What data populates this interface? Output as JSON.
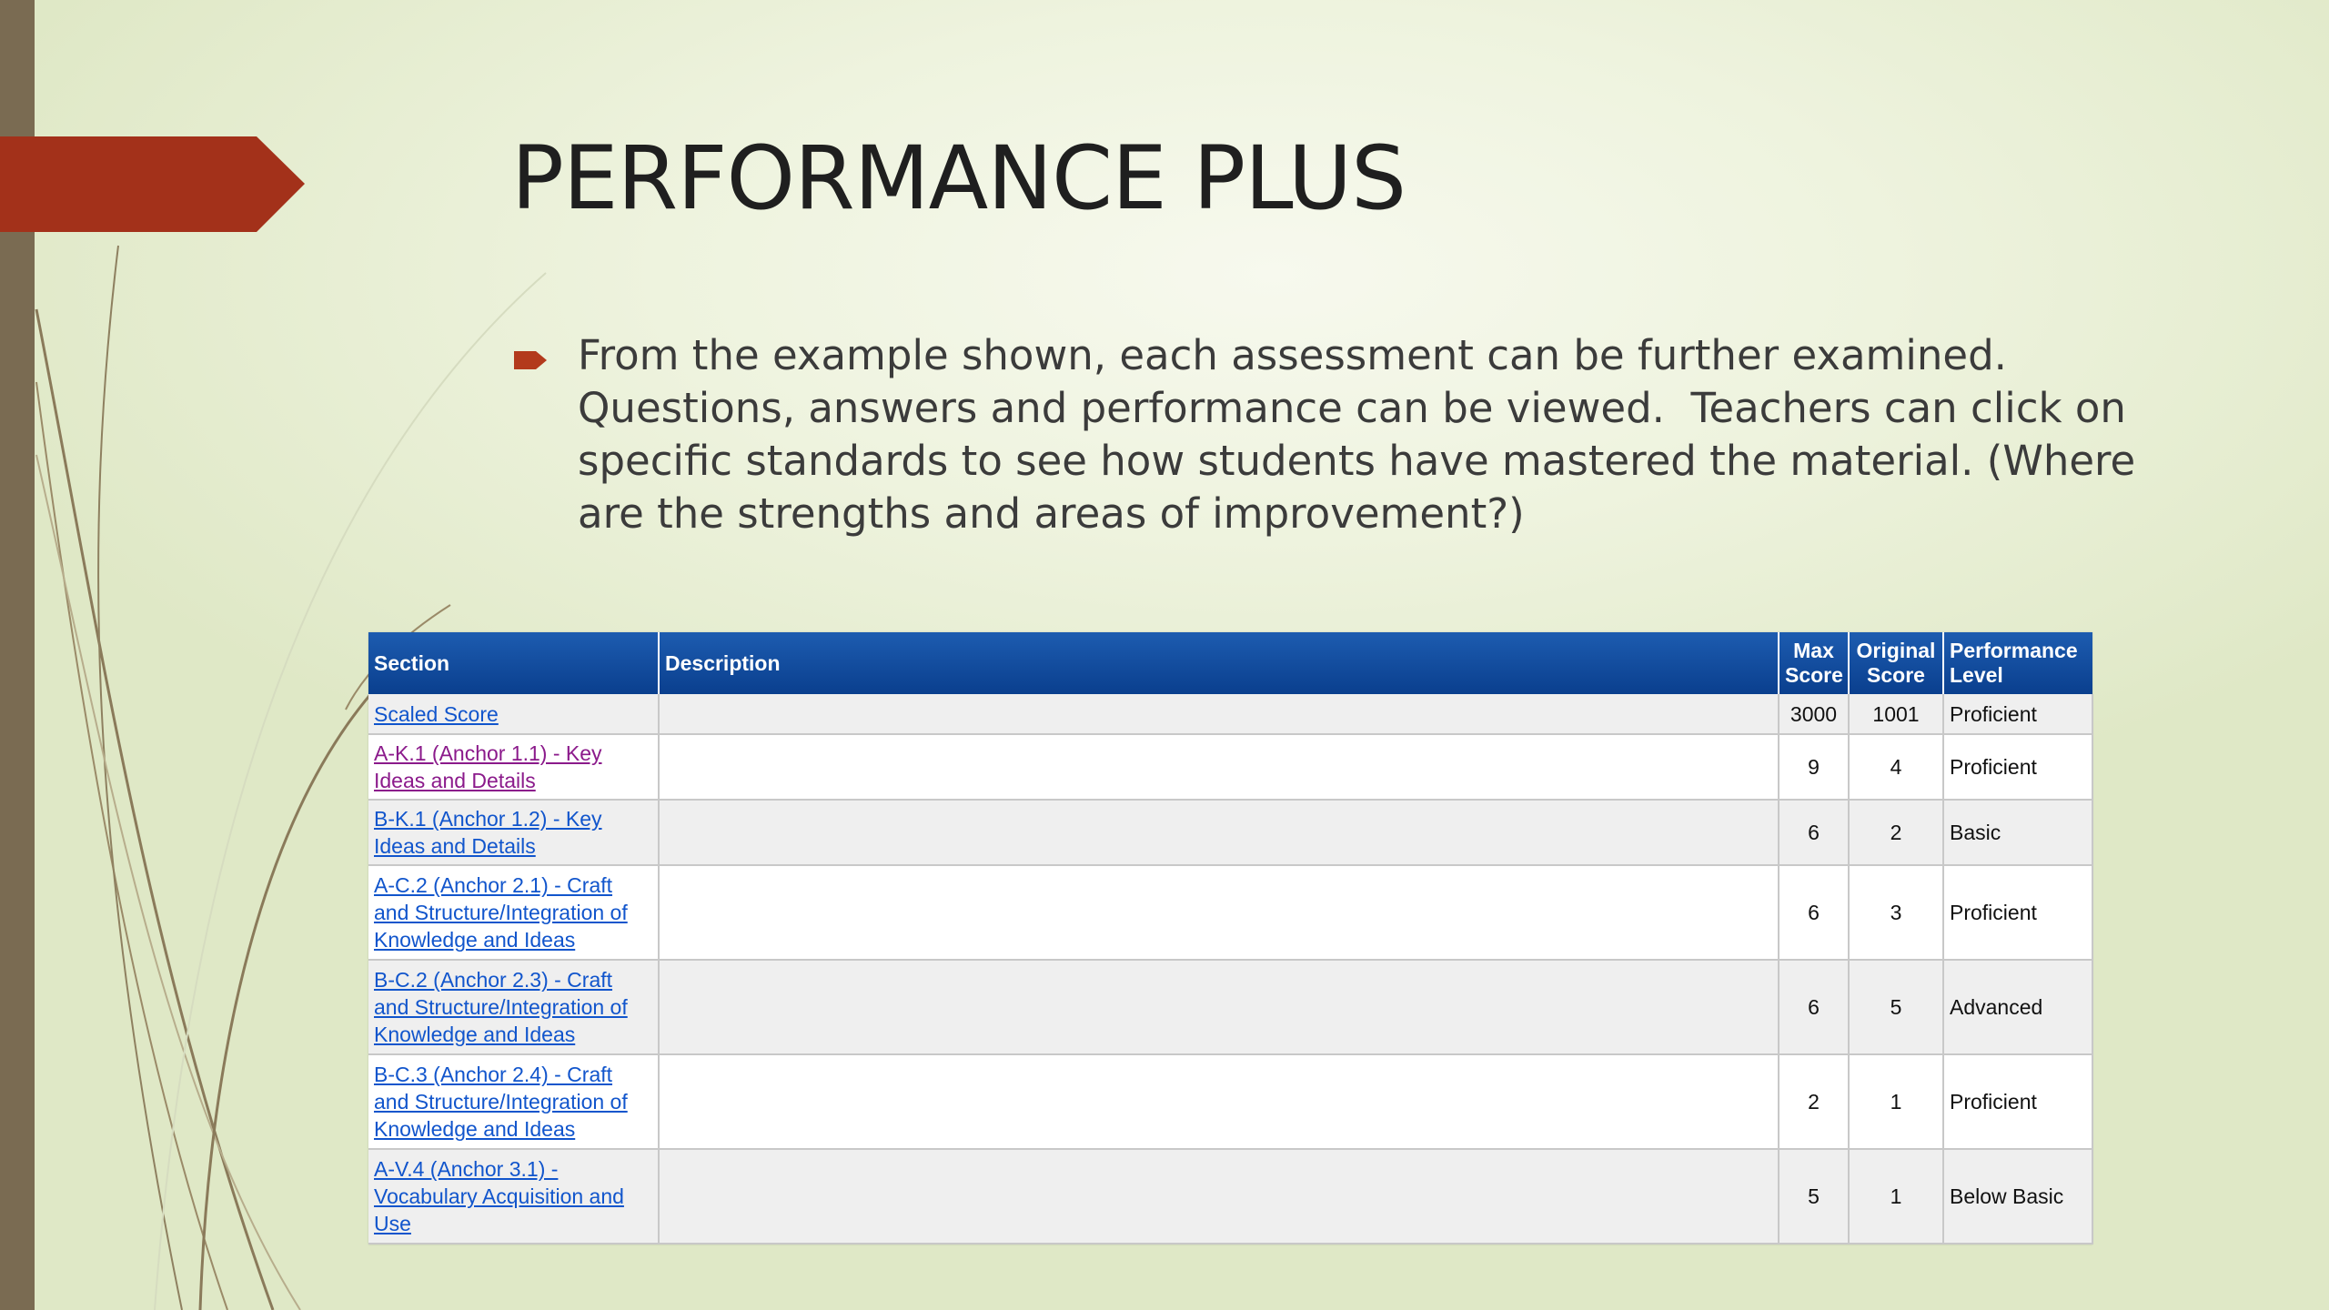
{
  "slide": {
    "title": "PERFORMANCE PLUS",
    "bullet": "From the example shown, each assessment can be further examined. Questions, answers and performance can be viewed.  Teachers can click on specific standards to see how students have mastered the material. (Where are the strengths and areas of improvement?)"
  },
  "colors": {
    "accent_flag": "#a3311a",
    "header_blue": "#0a3f8e",
    "link": "#1155cc",
    "visited_link": "#8b1a8b"
  },
  "table": {
    "headers": {
      "section": "Section",
      "description": "Description",
      "max_score": "Max Score",
      "original_score": "Original Score",
      "performance_level": "Performance Level"
    },
    "rows": [
      {
        "section": "Scaled Score",
        "description": "",
        "max": "3000",
        "original": "1001",
        "level": "Proficient"
      },
      {
        "section": "A-K.1 (Anchor 1.1) - Key Ideas and Details",
        "description": "",
        "max": "9",
        "original": "4",
        "level": "Proficient"
      },
      {
        "section": "B-K.1 (Anchor 1.2) - Key Ideas and Details",
        "description": "",
        "max": "6",
        "original": "2",
        "level": "Basic"
      },
      {
        "section": "A-C.2 (Anchor 2.1) - Craft and Structure/Integration of Knowledge and Ideas",
        "description": "",
        "max": "6",
        "original": "3",
        "level": "Proficient"
      },
      {
        "section": "B-C.2 (Anchor 2.3) - Craft and Structure/Integration of Knowledge and Ideas",
        "description": "",
        "max": "6",
        "original": "5",
        "level": "Advanced"
      },
      {
        "section": "B-C.3 (Anchor 2.4) - Craft and Structure/Integration of Knowledge and Ideas",
        "description": "",
        "max": "2",
        "original": "1",
        "level": "Proficient"
      },
      {
        "section": "A-V.4 (Anchor 3.1) - Vocabulary Acquisition and Use",
        "description": "",
        "max": "5",
        "original": "1",
        "level": "Below Basic"
      }
    ]
  }
}
